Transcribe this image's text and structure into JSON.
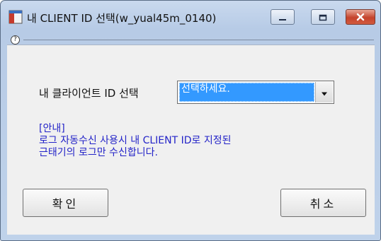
{
  "window": {
    "title": "내 CLIENT ID 선택(w_yual45m_0140)",
    "help_glyph": "?"
  },
  "form": {
    "label": "내 클라이언트 ID 선택",
    "select_value": "선택하세요."
  },
  "notice": {
    "heading": "[안내]",
    "line1": "로그 자동수신 사용시 내 CLIENT ID로 지정된",
    "line2": "근태기의 로그만 수신합니다."
  },
  "buttons": {
    "ok_label": "확인",
    "cancel_label": "취소"
  },
  "colors": {
    "notice_text": "#2323c8",
    "selection": "#3399ff",
    "close_button": "#c4432c"
  },
  "icons": {
    "app": "window-app-icon",
    "help": "help-icon",
    "minimize": "minimize-icon",
    "maximize": "maximize-icon",
    "close": "close-icon",
    "dropdown": "dropdown-arrow-icon"
  }
}
